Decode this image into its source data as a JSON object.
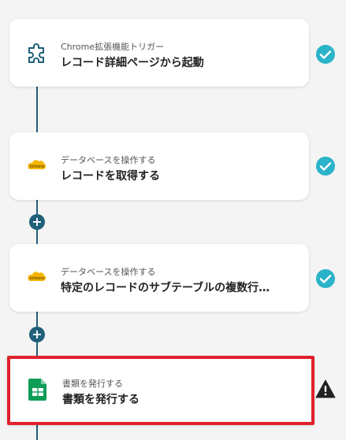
{
  "steps": [
    {
      "subtitle": "Chrome拡張機能トリガー",
      "title": "レコード詳細ページから起動",
      "icon": "puzzle-icon",
      "status": "complete"
    },
    {
      "subtitle": "データベースを操作する",
      "title": "レコードを取得する",
      "icon": "kintone-icon",
      "icon_label": "kintone",
      "status": "complete"
    },
    {
      "subtitle": "データベースを操作する",
      "title": "特定のレコードのサブテーブルの複数行…",
      "icon": "kintone-icon",
      "icon_label": "kintone",
      "status": "complete"
    },
    {
      "subtitle": "書類を発行する",
      "title": "書類を発行する",
      "icon": "google-sheets-icon",
      "status": "warning",
      "selected": true
    }
  ],
  "add_step_symbol": "+",
  "colors": {
    "connector": "#1f5f7a",
    "check": "#2ab3c9",
    "selected_border": "#e0222d",
    "kintone": "#f5b400",
    "sheets": "#0f9d58"
  }
}
